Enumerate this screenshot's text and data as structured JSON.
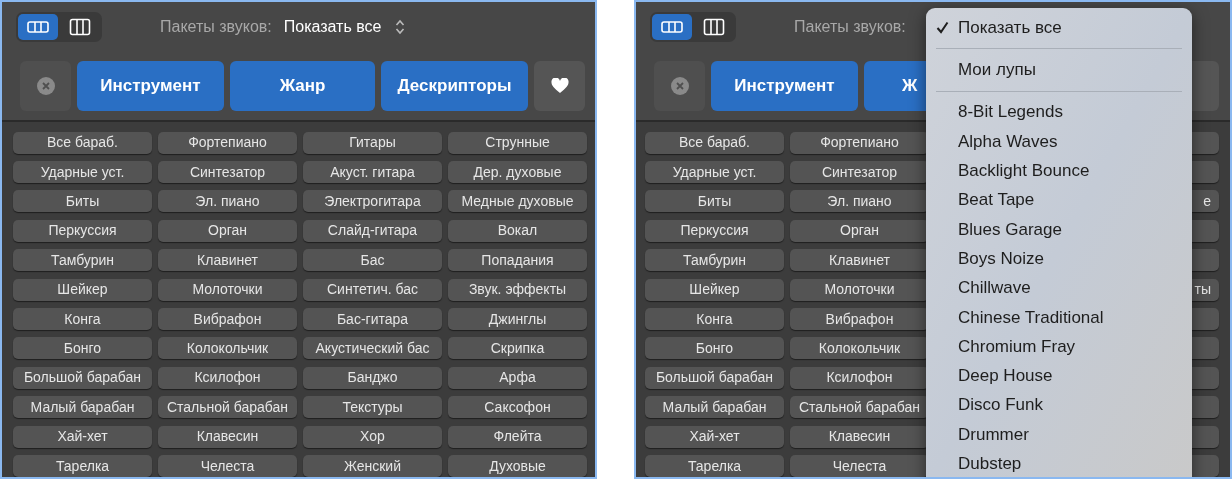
{
  "left_panel": {
    "view_toggle": [
      {
        "kind": "rows",
        "selected": true
      },
      {
        "kind": "columns",
        "selected": false
      }
    ],
    "sound_packs": {
      "label": "Пакеты звуков:",
      "value": "Показать все"
    },
    "filter_buttons": [
      "Инструмент",
      "Жанр",
      "Дескрипторы"
    ],
    "tags": [
      [
        "Все бараб.",
        "Фортепиано",
        "Гитары",
        "Струнные"
      ],
      [
        "Ударные уст.",
        "Синтезатор",
        "Акуст. гитара",
        "Дер. духовые"
      ],
      [
        "Биты",
        "Эл. пиано",
        "Электрогитара",
        "Медные духовые"
      ],
      [
        "Перкуссия",
        "Орган",
        "Слайд-гитара",
        "Вокал"
      ],
      [
        "Тамбурин",
        "Клавинет",
        "Бас",
        "Попадания"
      ],
      [
        "Шейкер",
        "Молоточки",
        "Синтетич. бас",
        "Звук. эффекты"
      ],
      [
        "Конга",
        "Вибрафон",
        "Бас-гитара",
        "Джинглы"
      ],
      [
        "Бонго",
        "Колокольчик",
        "Акустический бас",
        "Скрипка"
      ],
      [
        "Большой барабан",
        "Ксилофон",
        "Банджо",
        "Арфа"
      ],
      [
        "Малый барабан",
        "Стальной барабан",
        "Текстуры",
        "Саксофон"
      ],
      [
        "Хай-хет",
        "Клавесин",
        "Хор",
        "Флейта"
      ],
      [
        "Тарелка",
        "Челеста",
        "Женский",
        "Духовые"
      ]
    ]
  },
  "right_panel": {
    "view_toggle": [
      {
        "kind": "rows",
        "selected": true
      },
      {
        "kind": "columns",
        "selected": false
      }
    ],
    "sound_packs": {
      "label": "Пакеты звуков:"
    },
    "filter_buttons": [
      "Инструмент",
      "Ж"
    ],
    "tags": [
      {
        "column_1": "Все бараб.",
        "column_2": "Фортепиано"
      },
      {
        "column_1": "Ударные уст.",
        "column_2": "Синтезатор"
      },
      {
        "column_1": "Биты",
        "column_2": "Эл. пиано",
        "column_4": "е"
      },
      {
        "column_1": "Перкуссия",
        "column_2": "Орган"
      },
      {
        "column_1": "Тамбурин",
        "column_2": "Клавинет"
      },
      {
        "column_1": "Шейкер",
        "column_2": "Молоточки",
        "column_4": "ты"
      },
      {
        "column_1": "Конга",
        "column_2": "Вибрафон"
      },
      {
        "column_1": "Бонго",
        "column_2": "Колокольчик"
      },
      {
        "column_1": "Большой барабан",
        "column_2": "Ксилофон"
      },
      {
        "column_1": "Малый барабан",
        "column_2": "Стальной барабан"
      },
      {
        "column_1": "Хай-хет",
        "column_2": "Клавесин"
      },
      {
        "column_1": "Тарелка",
        "column_2": "Челеста"
      }
    ],
    "dropdown_menu": {
      "sections": [
        [
          {
            "label": "Показать все",
            "checked": true
          }
        ],
        [
          {
            "label": "Мои лупы",
            "checked": false
          }
        ],
        [
          {
            "label": "8-Bit Legends",
            "checked": false
          },
          {
            "label": "Alpha Waves",
            "checked": false
          },
          {
            "label": "Backlight Bounce",
            "checked": false
          },
          {
            "label": "Beat Tape",
            "checked": false
          },
          {
            "label": "Blues Garage",
            "checked": false
          },
          {
            "label": "Boys Noize",
            "checked": false
          },
          {
            "label": "Chillwave",
            "checked": false
          },
          {
            "label": "Chinese Traditional",
            "checked": false
          },
          {
            "label": "Chromium Fray",
            "checked": false
          },
          {
            "label": "Deep House",
            "checked": false
          },
          {
            "label": "Disco Funk",
            "checked": false
          },
          {
            "label": "Drummer",
            "checked": false
          },
          {
            "label": "Dubstep",
            "checked": false
          }
        ]
      ]
    }
  }
}
